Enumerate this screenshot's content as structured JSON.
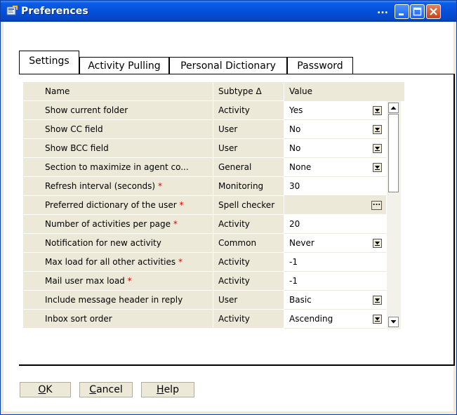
{
  "window": {
    "title": "Preferences",
    "title_extra": "...",
    "accent": "#0a5ce6",
    "close_color": "#c9411a"
  },
  "tabs": [
    {
      "label": "Settings",
      "active": true
    },
    {
      "label": "Activity Pulling",
      "active": false
    },
    {
      "label": "Personal Dictionary",
      "active": false
    },
    {
      "label": "Password",
      "active": false
    }
  ],
  "table": {
    "columns": [
      "Name",
      "Subtype Δ",
      "Value"
    ],
    "rows": [
      {
        "name": "Show current folder",
        "required": false,
        "subtype": "Activity",
        "value": "Yes",
        "control": "dropdown"
      },
      {
        "name": "Show CC field",
        "required": false,
        "subtype": "User",
        "value": "No",
        "control": "dropdown"
      },
      {
        "name": "Show BCC field",
        "required": false,
        "subtype": "User",
        "value": "No",
        "control": "dropdown"
      },
      {
        "name": "Section to maximize in agent co...",
        "required": false,
        "subtype": "General",
        "value": "None",
        "control": "dropdown"
      },
      {
        "name": "Refresh interval (seconds)",
        "required": true,
        "subtype": "Monitoring",
        "value": "30",
        "control": "text"
      },
      {
        "name": "Preferred dictionary of the user",
        "required": true,
        "subtype": "Spell checker",
        "value": "",
        "control": "browse"
      },
      {
        "name": "Number of activities per page",
        "required": true,
        "subtype": "Activity",
        "value": "20",
        "control": "text"
      },
      {
        "name": "Notification for new activity",
        "required": false,
        "subtype": "Common",
        "value": "Never",
        "control": "dropdown"
      },
      {
        "name": "Max load for all other activities",
        "required": true,
        "subtype": "Activity",
        "value": "-1",
        "control": "text"
      },
      {
        "name": "Mail user max load",
        "required": true,
        "subtype": "Activity",
        "value": "-1",
        "control": "text"
      },
      {
        "name": "Include message header in reply",
        "required": false,
        "subtype": "User",
        "value": "Basic",
        "control": "dropdown"
      },
      {
        "name": "Inbox sort order",
        "required": false,
        "subtype": "Activity",
        "value": "Ascending",
        "control": "dropdown"
      }
    ],
    "required_marker": "*",
    "browse_label": "..."
  },
  "buttons": {
    "ok": {
      "mnemonic": "O",
      "rest": "K"
    },
    "cancel": {
      "mnemonic": "C",
      "rest": "ancel"
    },
    "help": {
      "mnemonic": "H",
      "rest": "elp"
    }
  },
  "colors": {
    "required": "#e00000",
    "panel": "#ece9d8"
  }
}
